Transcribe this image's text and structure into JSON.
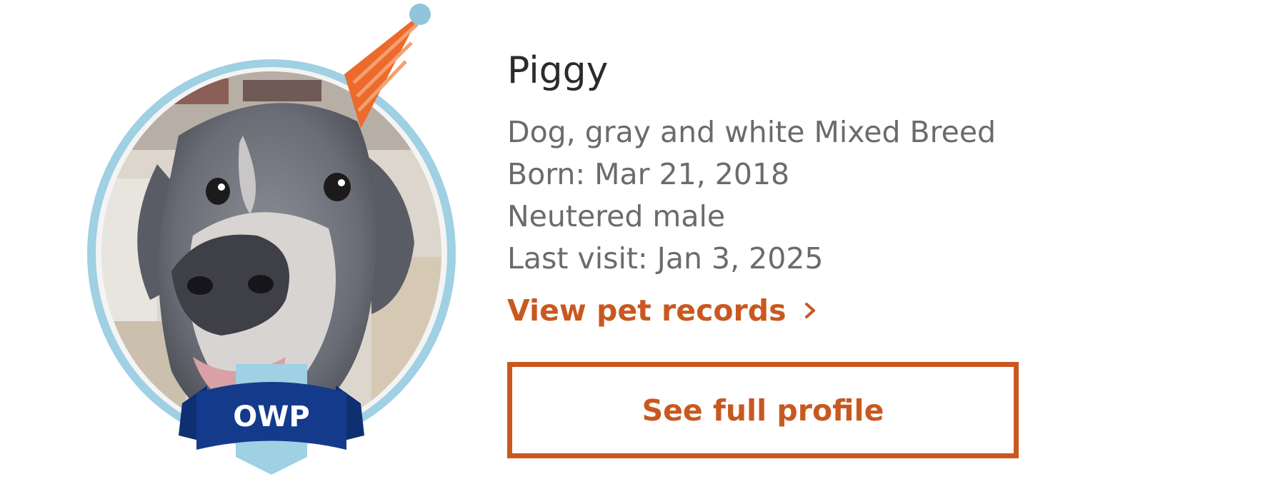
{
  "pet": {
    "name": "Piggy",
    "description": "Dog, gray and white Mixed Breed",
    "born": "Born: Mar 21, 2018",
    "sex": "Neutered male",
    "last_visit": "Last visit: Jan 3, 2025"
  },
  "badge": {
    "label": "OWP"
  },
  "links": {
    "records_label": "View pet records",
    "chevron_icon": "chevron-right-icon"
  },
  "buttons": {
    "profile_label": "See full profile"
  },
  "colors": {
    "accent": "#c9581f",
    "ring": "#9fd0e3",
    "badge_blue": "#143a8c",
    "party_hat": "#ec6a2b",
    "name_text": "#2b2b2b",
    "detail_text": "#6b6b6b"
  }
}
